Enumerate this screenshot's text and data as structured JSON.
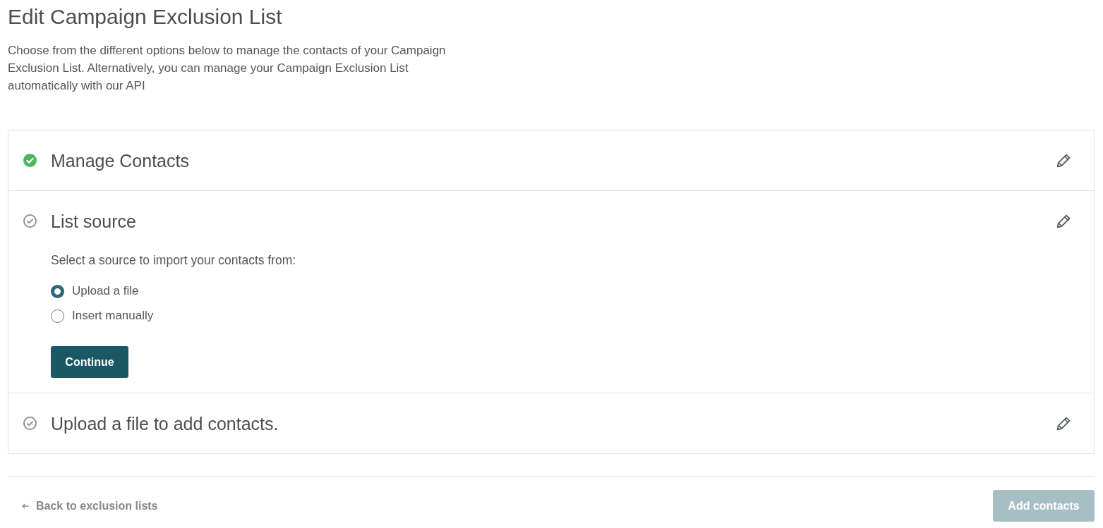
{
  "page": {
    "title": "Edit Campaign Exclusion List",
    "description": "Choose from the different options below to manage the contacts of your Campaign Exclusion List. Alternatively, you can manage your Campaign Exclusion List automatically with our API"
  },
  "steps": [
    {
      "title": "Manage Contacts",
      "complete": true
    },
    {
      "title": "List source",
      "complete": false,
      "prompt": "Select a source to import your contacts from:",
      "options": [
        {
          "label": "Upload a file",
          "selected": true
        },
        {
          "label": "Insert manually",
          "selected": false
        }
      ],
      "button": "Continue"
    },
    {
      "title": "Upload a file to add contacts.",
      "complete": false
    }
  ],
  "footer": {
    "back_link": "Back to exclusion lists",
    "add_button": {
      "label": "Add contacts",
      "disabled": true
    }
  }
}
